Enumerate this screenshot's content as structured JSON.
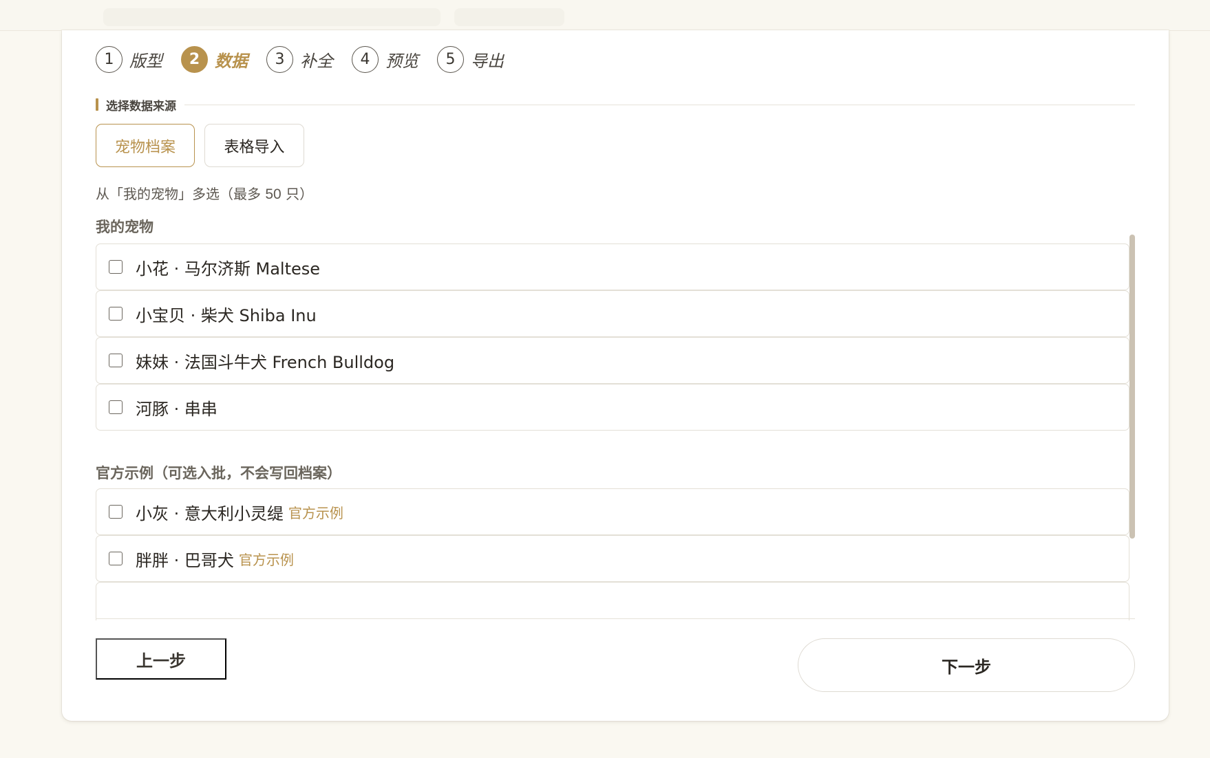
{
  "stepper": {
    "steps": [
      {
        "num": "1",
        "label": "版型"
      },
      {
        "num": "2",
        "label": "数据"
      },
      {
        "num": "3",
        "label": "补全"
      },
      {
        "num": "4",
        "label": "预览"
      },
      {
        "num": "5",
        "label": "导出"
      }
    ],
    "active_step": 2
  },
  "section": {
    "title": "选择数据来源"
  },
  "source_tabs": {
    "pets": "宠物档案",
    "table": "表格导入",
    "selected": "pets"
  },
  "hint": {
    "prefix": "从「我的宠物」多选（最多 ",
    "num": "50",
    "suffix": " 只）"
  },
  "my_pets": {
    "title": "我的宠物",
    "items": [
      {
        "label": "小花 · 马尔济斯 Maltese"
      },
      {
        "label": "小宝贝 · 柴犬 Shiba Inu"
      },
      {
        "label": "妹妹 · 法国斗牛犬 French Bulldog"
      },
      {
        "label": "河豚 · 串串"
      }
    ]
  },
  "official": {
    "title": "官方示例（可选入批，不会写回档案）",
    "items": [
      {
        "label": "小灰 · 意大利小灵缇",
        "tag": "官方示例"
      },
      {
        "label": "胖胖 · 巴哥犬",
        "tag": "官方示例"
      }
    ]
  },
  "footer": {
    "prev": "上一步",
    "next": "下一步"
  },
  "colors": {
    "accent": "#b8924d",
    "background": "#faf8f1",
    "card": "#ffffff"
  }
}
